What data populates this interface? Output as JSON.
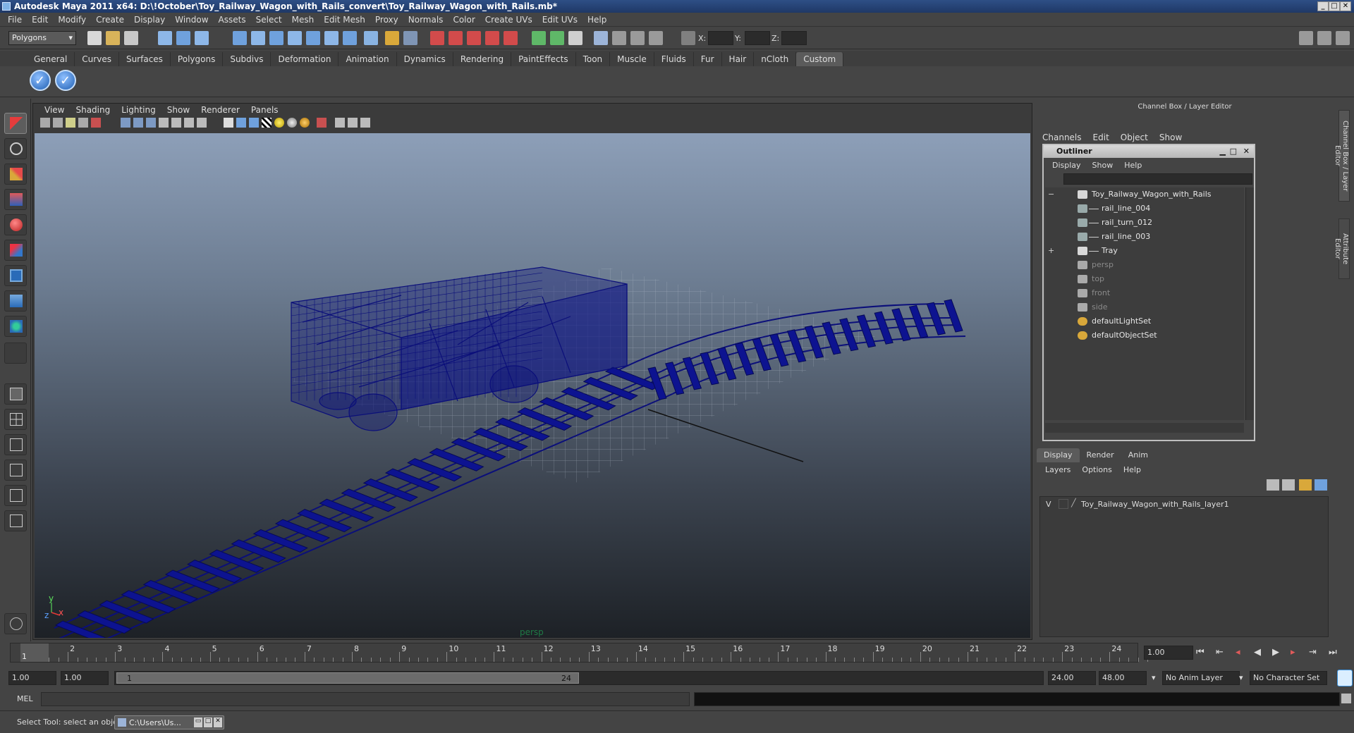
{
  "title": "Autodesk Maya 2011 x64: D:\\!October\\Toy_Railway_Wagon_with_Rails_convert\\Toy_Railway_Wagon_with_Rails.mb*",
  "menu": [
    "File",
    "Edit",
    "Modify",
    "Create",
    "Display",
    "Window",
    "Assets",
    "Select",
    "Mesh",
    "Edit Mesh",
    "Proxy",
    "Normals",
    "Color",
    "Create UVs",
    "Edit UVs",
    "Help"
  ],
  "mode_selector": "Polygons",
  "coord_labels": {
    "x": "X:",
    "y": "Y:",
    "z": "Z:"
  },
  "shelf_tabs": [
    "General",
    "Curves",
    "Surfaces",
    "Polygons",
    "Subdivs",
    "Deformation",
    "Animation",
    "Dynamics",
    "Rendering",
    "PaintEffects",
    "Toon",
    "Muscle",
    "Fluids",
    "Fur",
    "Hair",
    "nCloth",
    "Custom"
  ],
  "active_shelf_tab": "Custom",
  "viewport": {
    "menu": [
      "View",
      "Shading",
      "Lighting",
      "Show",
      "Renderer",
      "Panels"
    ],
    "camera_label": "persp",
    "axis_y": "y",
    "axis_x": "x",
    "axis_z": "z"
  },
  "channel_box": {
    "header": "Channel Box / Layer Editor",
    "menu": [
      "Channels",
      "Edit",
      "Object",
      "Show"
    ]
  },
  "outliner": {
    "title": "Outliner",
    "menu": [
      "Display",
      "Show",
      "Help"
    ],
    "items": [
      {
        "label": "Toy_Railway_Wagon_with_Rails",
        "indent": 0,
        "expand": "−",
        "type": "group",
        "dim": false
      },
      {
        "label": "rail_line_004",
        "indent": 1,
        "expand": "",
        "type": "mesh",
        "dim": false
      },
      {
        "label": "rail_turn_012",
        "indent": 1,
        "expand": "",
        "type": "mesh",
        "dim": false
      },
      {
        "label": "rail_line_003",
        "indent": 1,
        "expand": "",
        "type": "mesh",
        "dim": false
      },
      {
        "label": "Tray",
        "indent": 1,
        "expand": "+",
        "type": "group",
        "dim": false
      },
      {
        "label": "persp",
        "indent": 0,
        "expand": "",
        "type": "camera",
        "dim": true
      },
      {
        "label": "top",
        "indent": 0,
        "expand": "",
        "type": "camera",
        "dim": true
      },
      {
        "label": "front",
        "indent": 0,
        "expand": "",
        "type": "camera",
        "dim": true
      },
      {
        "label": "side",
        "indent": 0,
        "expand": "",
        "type": "camera",
        "dim": true
      },
      {
        "label": "defaultLightSet",
        "indent": 0,
        "expand": "",
        "type": "set",
        "dim": false
      },
      {
        "label": "defaultObjectSet",
        "indent": 0,
        "expand": "",
        "type": "set",
        "dim": false
      }
    ]
  },
  "layer_editor": {
    "tabs": [
      "Display",
      "Render",
      "Anim"
    ],
    "active_tab": "Display",
    "menu": [
      "Layers",
      "Options",
      "Help"
    ],
    "layers": [
      {
        "visible": "V",
        "name": "Toy_Railway_Wagon_with_Rails_layer1"
      }
    ]
  },
  "side_tabs": [
    "Channel Box / Layer Editor",
    "Attribute Editor"
  ],
  "timeline": {
    "ticks": [
      "1",
      "2",
      "3",
      "4",
      "5",
      "6",
      "7",
      "8",
      "9",
      "10",
      "11",
      "12",
      "13",
      "14",
      "15",
      "16",
      "17",
      "18",
      "19",
      "20",
      "21",
      "22",
      "23",
      "24"
    ],
    "current_frame": "1.00",
    "current_marker": "1"
  },
  "range": {
    "start": "1.00",
    "playback_start": "1.00",
    "slider_start": "1",
    "slider_end": "24",
    "playback_end": "24.00",
    "end": "48.00",
    "anim_layer": "No Anim Layer",
    "character_set": "No Character Set"
  },
  "command_line": {
    "label": "MEL"
  },
  "help_line": "Select Tool: select an object",
  "taskbar_item": "C:\\Users\\Us...",
  "colors": {
    "wire": "#0b0f7a",
    "accent": "#1f3866"
  }
}
